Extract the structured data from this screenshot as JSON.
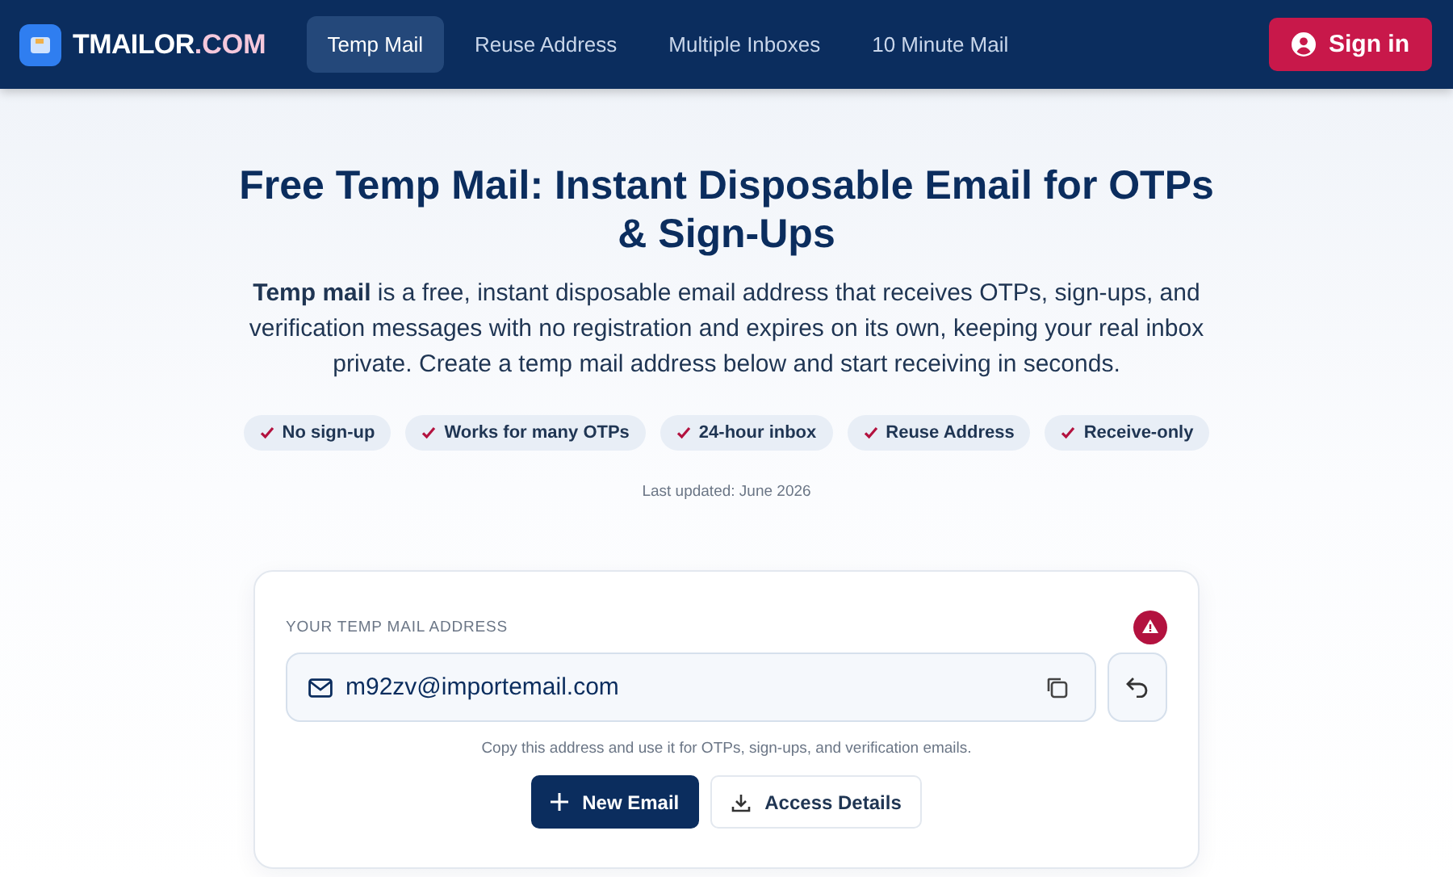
{
  "header": {
    "logo": {
      "name": "TMAILOR",
      "suffix": ".COM"
    },
    "nav": [
      {
        "label": "Temp Mail",
        "selected": true
      },
      {
        "label": "Reuse Address",
        "selected": false
      },
      {
        "label": "Multiple Inboxes",
        "selected": false
      },
      {
        "label": "10 Minute Mail",
        "selected": false
      }
    ],
    "sign_in": "Sign in"
  },
  "hero": {
    "title": "Free Temp Mail: Instant Disposable Email for OTPs & Sign-Ups",
    "intro": "**Temp mail** is a free, instant disposable email address that receives OTPs, sign-ups, and verification messages with no registration and expires on its own, keeping your real inbox private. Create a temp mail address below and start receiving in seconds.",
    "features": [
      "No sign-up",
      "Works for many OTPs",
      "24-hour inbox",
      "Reuse Address",
      "Receive-only"
    ],
    "updated": "Last updated: June 2026"
  },
  "address_card": {
    "label": "YOUR TEMP MAIL ADDRESS",
    "address": "m92zv@importemail.com",
    "hint": "Copy this address and use it for OTPs, sign-ups, and verification emails.",
    "buttons": [
      {
        "kind": "primary",
        "label": "New Email"
      },
      {
        "kind": "secondary",
        "label": "Access Details"
      }
    ]
  }
}
